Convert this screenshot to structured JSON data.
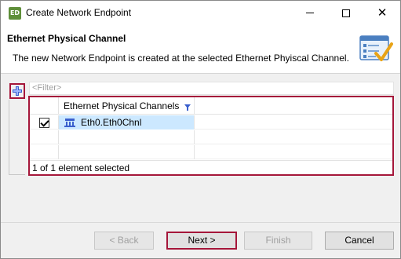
{
  "window": {
    "title": "Create Network Endpoint",
    "app_icon_text": "ED"
  },
  "banner": {
    "title": "Ethernet Physical Channel",
    "description": "The new Network Endpoint is created at the selected Ethernet Phyiscal Channel.",
    "icon": "wizard-checklist-icon"
  },
  "filter": {
    "placeholder": "<Filter>"
  },
  "table": {
    "columns": [
      "",
      "Ethernet Physical Channels"
    ],
    "rows": [
      {
        "checked": true,
        "icon": "ethernet-channel-icon",
        "name": "Eth0.Eth0Chnl"
      }
    ],
    "status": "1 of 1 element selected"
  },
  "buttons": {
    "back": "< Back",
    "next": "Next >",
    "finish": "Finish",
    "cancel": "Cancel"
  },
  "colors": {
    "highlight_border": "#a5163a",
    "selection": "#cce8ff",
    "accent": "#3a5fcd"
  }
}
